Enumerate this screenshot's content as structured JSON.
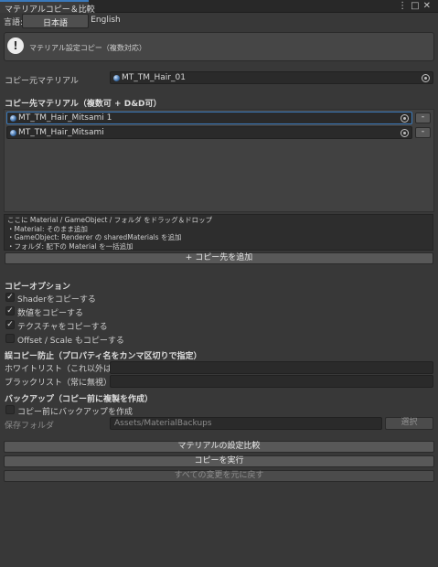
{
  "window": {
    "tab_title": "マテリアルコピー＆比較",
    "menu_icon": "vertical-dots-icon",
    "maximize_icon": "maximize-icon",
    "close_icon": "close-icon"
  },
  "language": {
    "label": "言語:",
    "options": [
      "日本語",
      "English"
    ],
    "selected": "日本語"
  },
  "help": {
    "icon": "!",
    "text": "マテリアル設定コピー（複数対応）"
  },
  "source": {
    "label": "コピー元マテリアル",
    "value": "MT_TM_Hair_01"
  },
  "targets": {
    "title": "コピー先マテリアル（複数可 + D&D可）",
    "items": [
      {
        "name": "MT_TM_Hair_Mitsami 1",
        "remove": "-"
      },
      {
        "name": "MT_TM_Hair_Mitsami",
        "remove": "-"
      }
    ],
    "dropinfo": [
      "ここに Material / GameObject / フォルダ をドラッグ＆ドロップ",
      "・Material: そのまま追加",
      "・GameObject: Renderer の sharedMaterials を追加",
      "・フォルダ: 配下の Material を一括追加"
    ],
    "add_button": "+ コピー先を追加"
  },
  "options": {
    "title": "コピーオプション",
    "items": [
      {
        "label": "Shaderをコピーする",
        "checked": true
      },
      {
        "label": "数値をコピーする",
        "checked": true
      },
      {
        "label": "テクスチャをコピーする",
        "checked": true
      },
      {
        "label": "Offset / Scale もコピーする",
        "checked": false
      }
    ]
  },
  "prevent": {
    "title": "誤コピー防止（プロパティ名をカンマ区切りで指定）",
    "whitelist_label": "ホワイトリスト（これ以外は無視",
    "blacklist_label": "ブラックリスト（常に無視）",
    "whitelist_value": "",
    "blacklist_value": ""
  },
  "backup": {
    "title": "バックアップ（コピー前に複製を作成）",
    "checkbox_label": "コピー前にバックアップを作成",
    "checked": false,
    "folder_label": "保存フォルダ",
    "folder_value": "Assets/MaterialBackups",
    "select_button": "選択"
  },
  "actions": {
    "compare": "マテリアルの設定比較",
    "execute": "コピーを実行",
    "revert": "すべての変更を元に戻す"
  },
  "check_mark": "✓"
}
